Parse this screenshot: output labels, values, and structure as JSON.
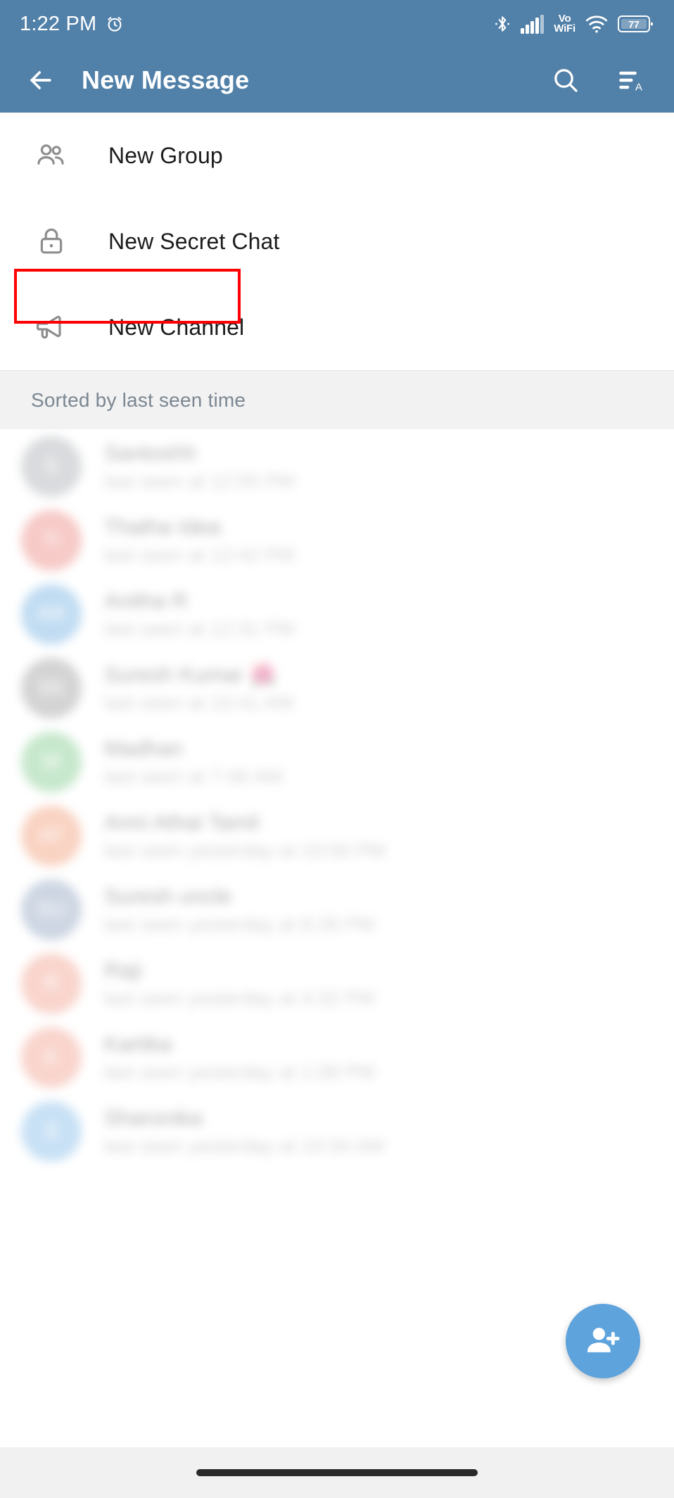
{
  "status_bar": {
    "time": "1:22 PM",
    "alarm_icon": "alarm-clock-icon",
    "bluetooth_icon": "bluetooth-icon",
    "signal_icon": "cellular-signal-icon",
    "vo_label": "Vo",
    "wifi_label": "WiFi",
    "wifi_icon": "wifi-icon",
    "battery_level": "77"
  },
  "app_bar": {
    "back_icon": "back-arrow-icon",
    "title": "New Message",
    "search_icon": "search-icon",
    "sort_icon": "sort-alphabetical-icon"
  },
  "actions": [
    {
      "label": "New Group",
      "icon": "group-people-icon",
      "highlighted": true
    },
    {
      "label": "New Secret Chat",
      "icon": "lock-icon",
      "highlighted": false
    },
    {
      "label": "New Channel",
      "icon": "megaphone-icon",
      "highlighted": false
    }
  ],
  "section": {
    "header": "Sorted by last seen time"
  },
  "contacts": [
    {
      "name": "Santoshh",
      "status": "last seen at 12:50 PM",
      "initials": "S",
      "color": "#9aa0a6"
    },
    {
      "name": "Thatha Idea",
      "status": "last seen at 12:42 PM",
      "initials": "TI",
      "color": "#e8736b"
    },
    {
      "name": "Anitha R",
      "status": "last seen at 12:31 PM",
      "initials": "AR",
      "color": "#5ba3dd"
    },
    {
      "name": "Suresh Kumar 🌺",
      "status": "last seen at 10:41 AM",
      "initials": "SK",
      "color": "#8d8d8d"
    },
    {
      "name": "Madhan",
      "status": "last seen at 7:46 AM",
      "initials": "M",
      "color": "#6cc27a"
    },
    {
      "name": "Anni Athai Tamil",
      "status": "last seen yesterday at 10:56 PM",
      "initials": "AT",
      "color": "#ef8a5e"
    },
    {
      "name": "Suresh uncle",
      "status": "last seen yesterday at 6:26 PM",
      "initials": "SU",
      "color": "#7d93b5"
    },
    {
      "name": "Raji",
      "status": "last seen yesterday at 4:32 PM",
      "initials": "R",
      "color": "#ef8f7a"
    },
    {
      "name": "Kartika",
      "status": "last seen yesterday at 1:08 PM",
      "initials": "K",
      "color": "#ef8f7a"
    },
    {
      "name": "Sharonika",
      "status": "last seen yesterday at 10:34 AM",
      "initials": "S",
      "color": "#6fb0e5"
    }
  ],
  "fab": {
    "icon": "add-person-icon"
  },
  "nav_bar": {
    "home_pill": "home-gesture-pill"
  },
  "colors": {
    "app_bar": "#5180a8",
    "fab": "#5fa3dd",
    "highlight": "#ff0000",
    "section_bg": "#f2f2f2"
  }
}
